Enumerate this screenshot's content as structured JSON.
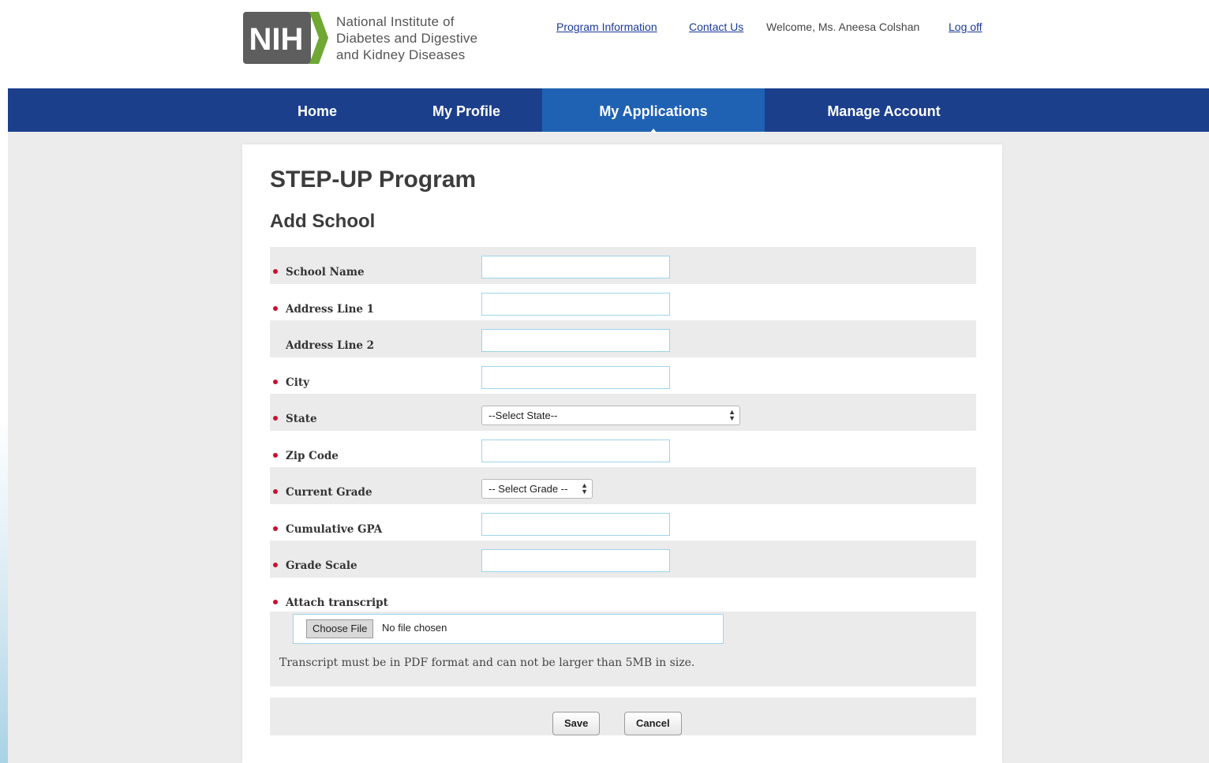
{
  "header": {
    "logo": {
      "mark": "NIH",
      "name_lines": [
        "National Institute of",
        "Diabetes and Digestive",
        "and Kidney Diseases"
      ]
    },
    "links": {
      "program_information": "Program Information",
      "contact_us": "Contact Us",
      "welcome": "Welcome, Ms. Aneesa Colshan",
      "log_off": "Log off"
    }
  },
  "nav": {
    "items": [
      {
        "label": "Home"
      },
      {
        "label": "My Profile"
      },
      {
        "label": "My Applications",
        "active": true
      },
      {
        "label": "Manage Account"
      }
    ]
  },
  "page": {
    "title": "STEP-UP Program",
    "section": "Add School"
  },
  "form": {
    "fields": [
      {
        "label": "School Name",
        "required": true,
        "value": ""
      },
      {
        "label": "Address Line 1",
        "required": true,
        "value": ""
      },
      {
        "label": "Address Line 2",
        "required": false,
        "value": ""
      },
      {
        "label": "City",
        "required": true,
        "value": ""
      },
      {
        "label": "State",
        "required": true,
        "selected": "--Select State--"
      },
      {
        "label": "Zip Code",
        "required": true,
        "value": ""
      },
      {
        "label": "Current Grade",
        "required": true,
        "selected": "-- Select Grade --"
      },
      {
        "label": "Cumulative GPA",
        "required": true,
        "value": ""
      },
      {
        "label": "Grade Scale",
        "required": true,
        "value": ""
      },
      {
        "label": "Attach transcript",
        "required": true
      }
    ],
    "file": {
      "button_label": "Choose File",
      "status": "No file chosen",
      "hint": "Transcript must be in PDF format and can not be larger than 5MB in size."
    },
    "actions": {
      "save": "Save",
      "cancel": "Cancel"
    }
  },
  "colors": {
    "nav_background": "#1c3f8c",
    "nav_active": "#1f62b3",
    "link": "#1a3a9a",
    "required_marker": "#c8102e",
    "input_border": "#9ed3ec",
    "logo_green": "#6fa832"
  }
}
